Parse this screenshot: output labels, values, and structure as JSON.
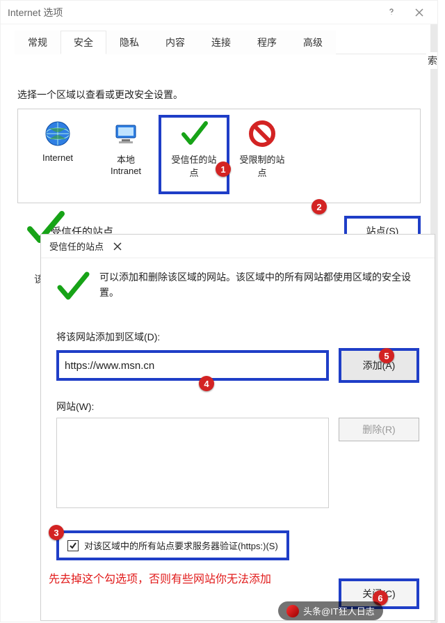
{
  "main": {
    "title": "Internet 选项",
    "tabs": [
      "常规",
      "安全",
      "隐私",
      "内容",
      "连接",
      "程序",
      "高级"
    ],
    "active_tab": 1,
    "right_hint": "索",
    "section_label": "选择一个区域以查看或更改安全设置。",
    "zones": [
      {
        "name": "Internet",
        "label": "Internet",
        "icon": "globe-icon"
      },
      {
        "name": "local-intranet",
        "label": "本地\nIntranet",
        "icon": "monitor-icon"
      },
      {
        "name": "trusted-sites",
        "label": "受信任的站\n点",
        "icon": "check-icon"
      },
      {
        "name": "restricted-sites",
        "label": "受限制的站\n点",
        "icon": "forbidden-icon"
      }
    ],
    "selected_zone": 2,
    "subheader": "受信任的站点",
    "sites_button": "站点(S)",
    "partial_label": "该"
  },
  "sub": {
    "title": "受信任的站点",
    "info": "可以添加和删除该区域的网站。该区域中的所有网站都使用区域的安全设置。",
    "add_label": "将该网站添加到区域(D):",
    "url_value": "https://www.msn.cn",
    "add_button": "添加(A)",
    "list_label": "网站(W):",
    "remove_button": "删除(R)",
    "require_https_label": "对该区域中的所有站点要求服务器验证(https:)(S)",
    "require_https_checked": true,
    "close_button": "关闭(C)"
  },
  "annotations": {
    "badges": {
      "b1": "1",
      "b2": "2",
      "b3": "3",
      "b4": "4",
      "b5": "5",
      "b6": "6"
    },
    "red_note": "先去掉这个勾选项，否则有些网站你无法添加",
    "watermark": "头条@IT狂人日志"
  }
}
